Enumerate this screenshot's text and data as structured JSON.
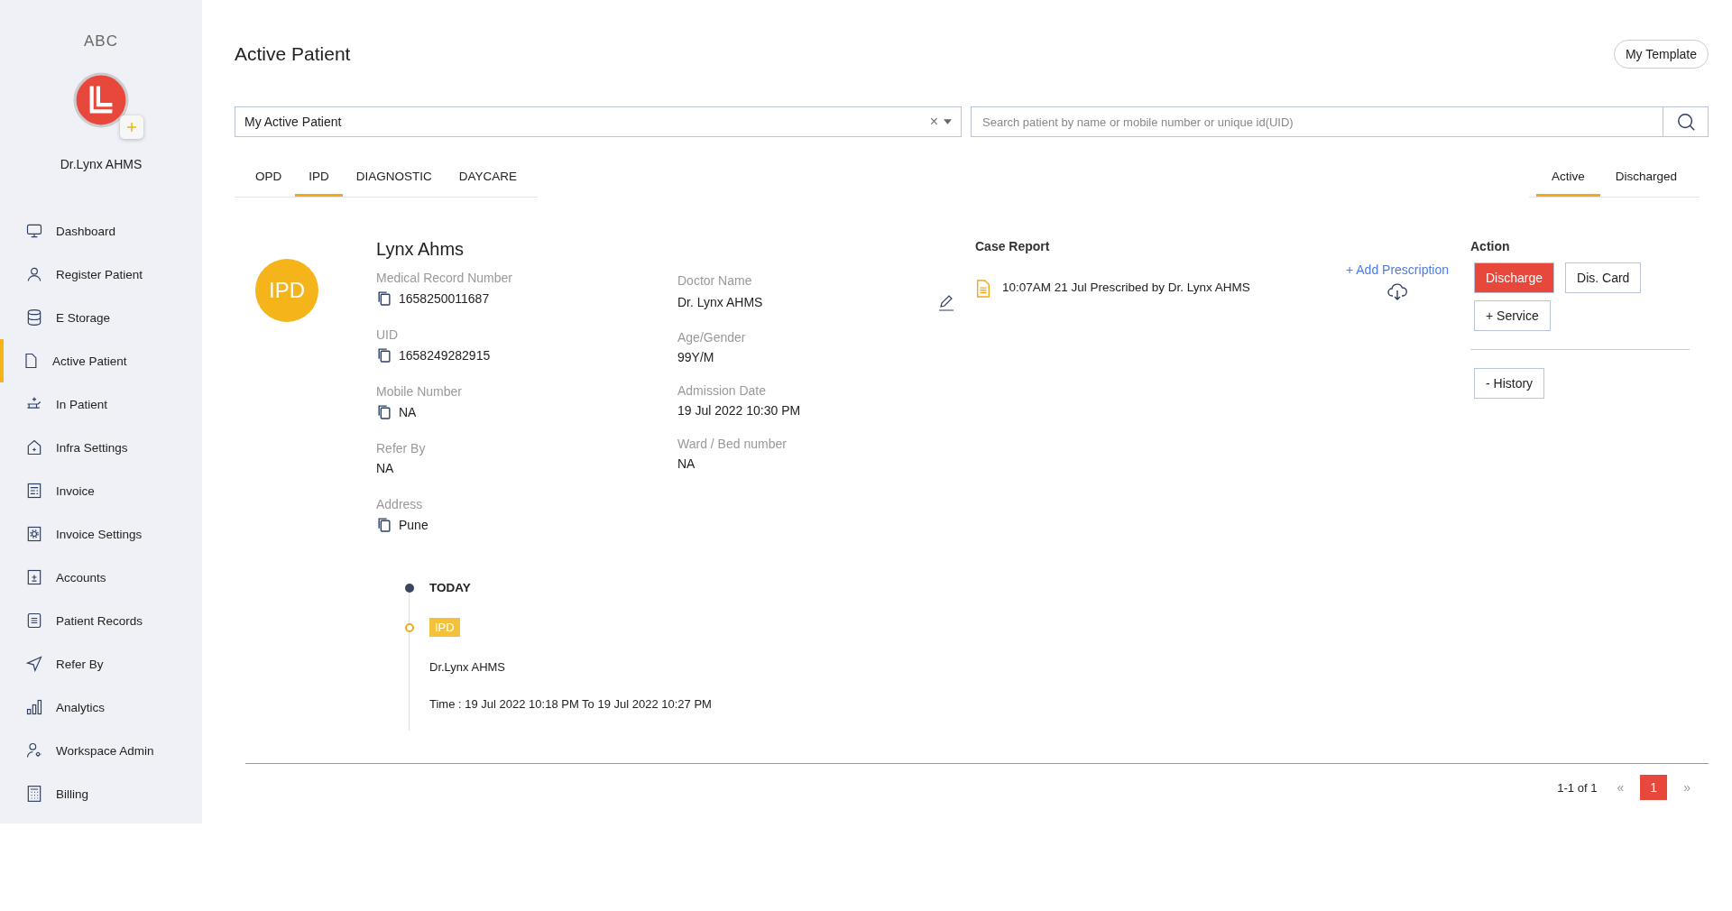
{
  "sidebar": {
    "org": "ABC",
    "user_name": "Dr.Lynx AHMS",
    "items": [
      {
        "label": "Dashboard",
        "selected": false
      },
      {
        "label": "Register Patient",
        "selected": false
      },
      {
        "label": "E Storage",
        "selected": false
      },
      {
        "label": "Active Patient",
        "selected": true
      },
      {
        "label": "In Patient",
        "selected": false
      },
      {
        "label": "Infra Settings",
        "selected": false
      },
      {
        "label": "Invoice",
        "selected": false
      },
      {
        "label": "Invoice Settings",
        "selected": false
      },
      {
        "label": "Accounts",
        "selected": false
      },
      {
        "label": "Patient Records",
        "selected": false
      },
      {
        "label": "Refer By",
        "selected": false
      },
      {
        "label": "Analytics",
        "selected": false
      },
      {
        "label": "Workspace Admin",
        "selected": false
      },
      {
        "label": "Billing",
        "selected": false
      }
    ]
  },
  "header": {
    "title": "Active Patient",
    "template_button": "My Template"
  },
  "filter": {
    "value": "My Active Patient",
    "clear": "×"
  },
  "search": {
    "placeholder": "Search patient by name or mobile number or unique id(UID)"
  },
  "type_tabs": [
    {
      "label": "OPD",
      "selected": false
    },
    {
      "label": "IPD",
      "selected": true
    },
    {
      "label": "DIAGNOSTIC",
      "selected": false
    },
    {
      "label": "DAYCARE",
      "selected": false
    }
  ],
  "status_tabs": [
    {
      "label": "Active",
      "selected": true
    },
    {
      "label": "Discharged",
      "selected": false
    }
  ],
  "patient": {
    "badge": "IPD",
    "name": "Lynx Ahms",
    "left_fields": [
      {
        "label": "Medical Record Number",
        "value": "1658250011687",
        "copy_icon": true
      },
      {
        "label": "UID",
        "value": "1658249282915",
        "copy_icon": true
      },
      {
        "label": "Mobile Number",
        "value": "NA",
        "copy_icon": true
      },
      {
        "label": "Refer By",
        "value": "NA",
        "copy_icon": false
      },
      {
        "label": "Address",
        "value": "Pune",
        "copy_icon": true
      }
    ],
    "right_fields": [
      {
        "label": "Doctor Name",
        "value": "Dr. Lynx AHMS"
      },
      {
        "label": "Age/Gender",
        "value": "99Y/M"
      },
      {
        "label": "Admission Date",
        "value": "19 Jul 2022 10:30 PM"
      },
      {
        "label": "Ward / Bed number",
        "value": "NA"
      }
    ],
    "case_report": {
      "title": "Case Report",
      "add_link": "+ Add Prescription",
      "entry": "10:07AM 21 Jul Prescribed by Dr. Lynx AHMS"
    },
    "action": {
      "title": "Action",
      "buttons": [
        {
          "label": "Discharge",
          "kind": "primary"
        },
        {
          "label": "Dis. Card",
          "kind": "outline"
        },
        {
          "label": "+ Service",
          "kind": "outline"
        }
      ],
      "history_button": "- History"
    }
  },
  "timeline": {
    "heading": "TODAY",
    "tag": "IPD",
    "doctor": "Dr.Lynx AHMS",
    "time": "Time : 19 Jul 2022 10:18 PM To 19 Jul 2022 10:27 PM"
  },
  "pagination": {
    "range": "1-1 of 1",
    "prev": "«",
    "pages": [
      {
        "label": "1",
        "selected": true
      }
    ],
    "next": "»"
  }
}
